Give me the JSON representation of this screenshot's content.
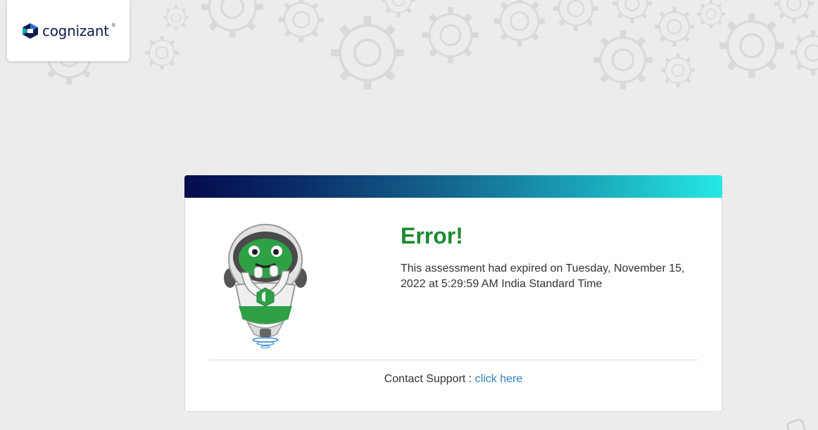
{
  "brand": {
    "name": "cognizant",
    "mark": "®",
    "colors": {
      "navy": "#0f1c4d",
      "blue": "#2e6bd6",
      "teal": "#1aa6b8"
    }
  },
  "error": {
    "title": "Error!",
    "message": "This assessment had expired on Tuesday, November 15, 2022 at 5:29:59 AM India Standard Time",
    "title_color": "#1d8a2f"
  },
  "support": {
    "label": "Contact Support : ",
    "link_text": "click here",
    "link_color": "#2f7fbf"
  },
  "icons": {
    "background": "gear-pattern-icon",
    "mascot": "robot-mascot-icon",
    "logo": "cognizant-logo-icon"
  }
}
